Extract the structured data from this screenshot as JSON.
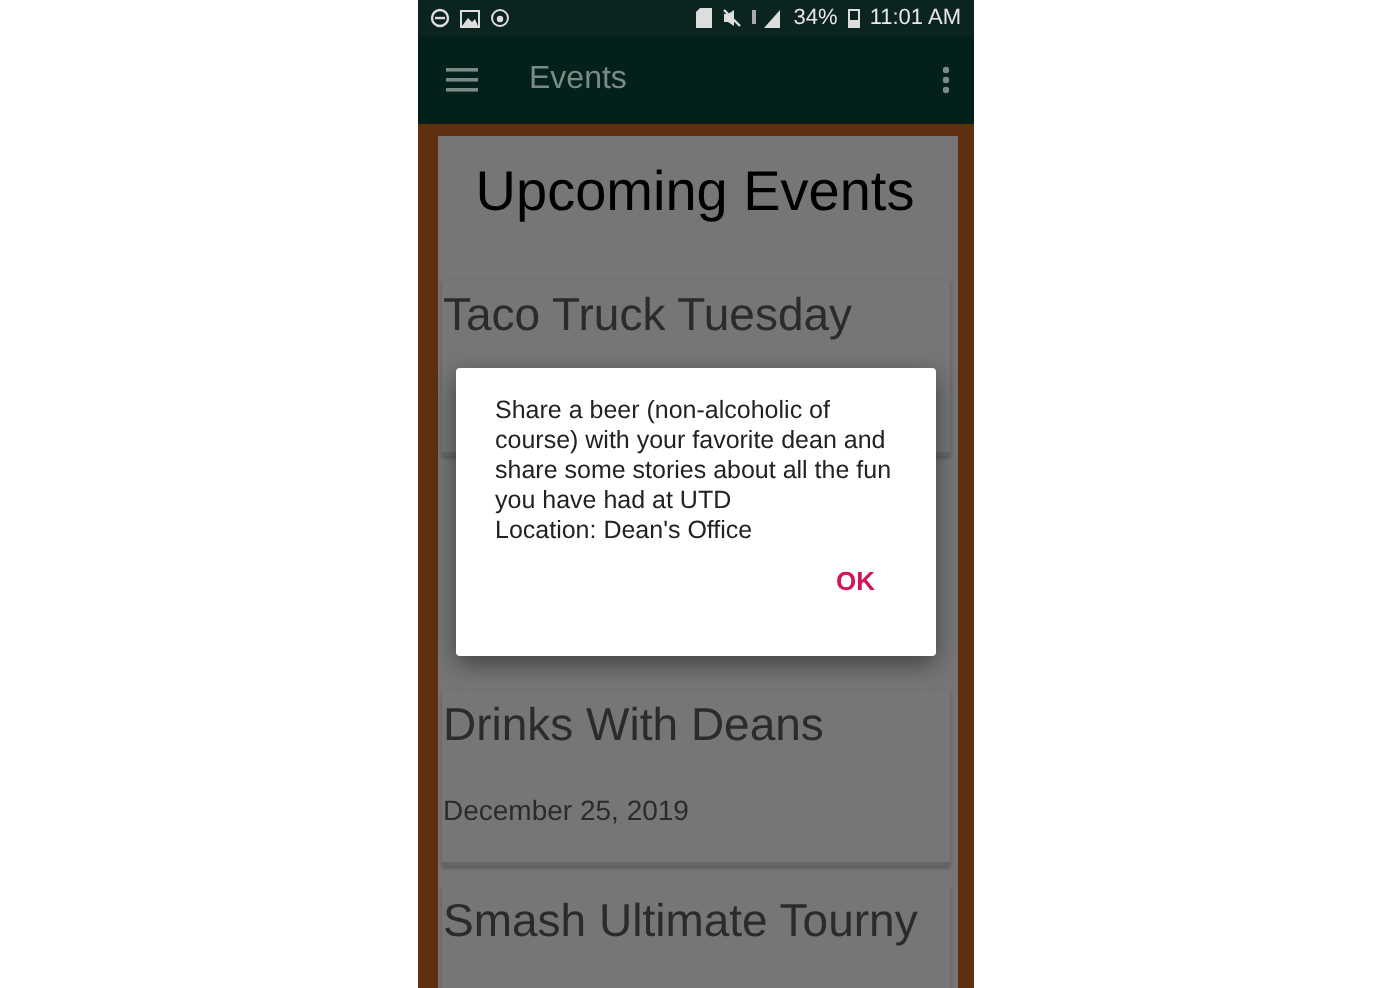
{
  "status_bar": {
    "battery": "34%",
    "time": "11:01 AM"
  },
  "app_bar": {
    "title": "Events"
  },
  "heading": "Upcoming Events",
  "events": [
    {
      "title": "Taco Truck Tuesday"
    },
    {
      "title": "Drinks With Deans",
      "date": "December 25, 2019"
    },
    {
      "title": "Smash Ultimate Tourny"
    }
  ],
  "dialog": {
    "message": "Share a beer (non-alcoholic of course) with your favorite dean and share some stories about all the fun you have had at UTD\nLocation: Dean's Office",
    "button": "OK"
  }
}
